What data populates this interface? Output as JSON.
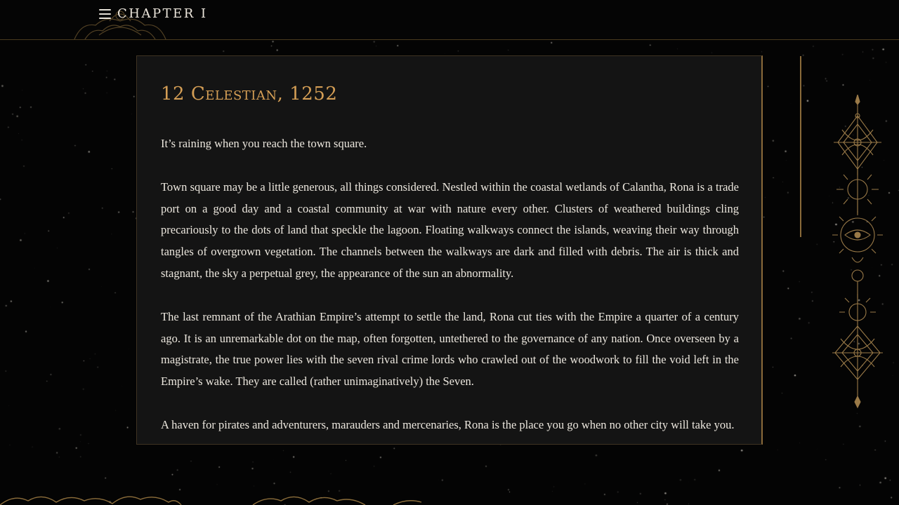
{
  "header": {
    "chapter_label": "CHAPTER I",
    "menu_icon": "hamburger-menu-icon"
  },
  "entry": {
    "date": "12 Celestian, 1252",
    "paragraphs": [
      "It’s raining when you reach the town square.",
      "Town square may be a little generous, all things considered. Nestled within the coastal wetlands of Calantha, Rona is a trade port on a good day and a coastal community at war with nature every other. Clusters of weathered buildings cling precariously to the dots of land that speckle the lagoon. Floating walkways connect the islands, weaving their way through tangles of overgrown vegetation. The channels between the walkways are dark and filled with debris. The air is thick and stagnant, the sky a perpetual grey, the appearance of the sun an abnormality.",
      "The last remnant of the Arathian Empire’s attempt to settle the land, Rona cut ties with the Empire a quarter of a century ago. It is an unremarkable dot on the map, often forgotten, untethered to the governance of any nation. Once overseen by a magistrate, the true power lies with the seven rival crime lords who crawled out of the woodwork to fill the void left in the Empire’s wake. They are called (rather unimaginatively) the Seven.",
      "A haven for pirates and adventurers, marauders and mercenaries, Rona is the place you go when no other city will take you."
    ]
  },
  "colors": {
    "background": "#040404",
    "panel": "#141414",
    "accent_gold": "#d49e55",
    "ornament_gold": "#8a6a3a",
    "text": "#ece7de"
  },
  "icons": [
    "hamburger-menu-icon",
    "celestial-ornament-icon",
    "eye-sun-icon",
    "mandala-ornament-icon"
  ]
}
